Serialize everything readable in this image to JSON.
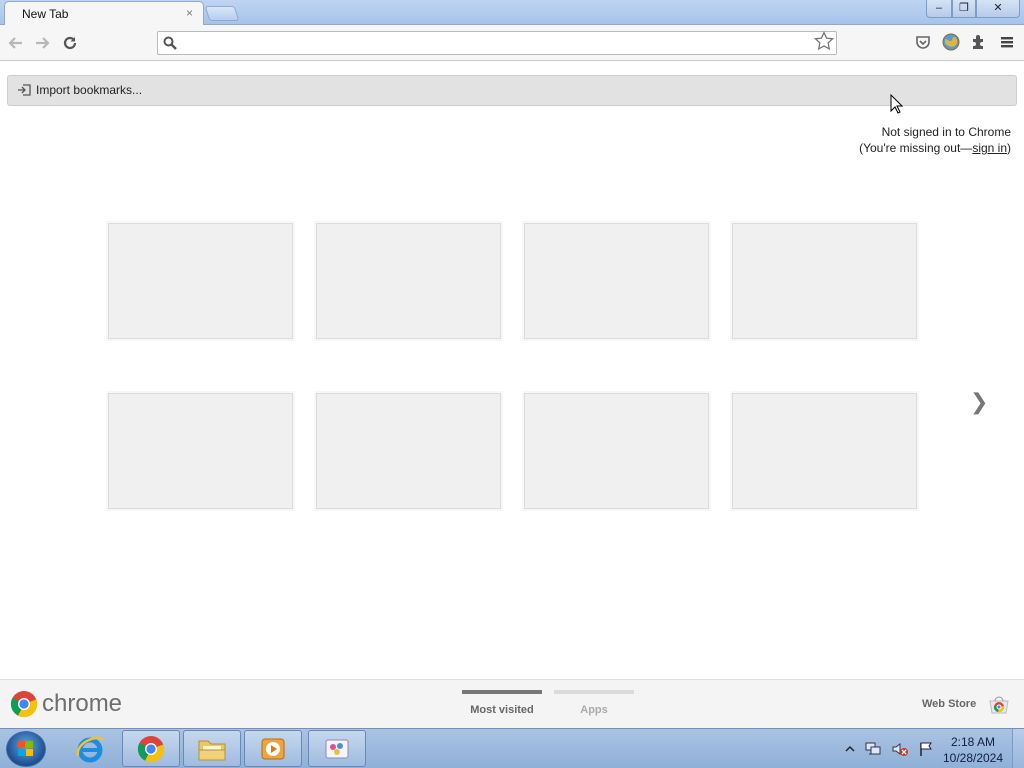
{
  "tab": {
    "title": "New Tab",
    "close": "×"
  },
  "window": {
    "minimize": "–",
    "maximize": "❐",
    "close": "✕"
  },
  "toolbar": {
    "omnibox_value": "",
    "omnibox_placeholder": ""
  },
  "bookmarks": {
    "import_label": "Import bookmarks..."
  },
  "signin": {
    "line1": "Not signed in to Chrome",
    "line2_prefix": "(You're missing out—",
    "link": "sign in",
    "line2_suffix": ")"
  },
  "tiles": {
    "count": 8
  },
  "next_arrow": "❯",
  "footer": {
    "brand": "chrome",
    "tabs": [
      {
        "label": "Most visited",
        "active": true
      },
      {
        "label": "Apps",
        "active": false
      }
    ],
    "webstore": "Web Store"
  },
  "taskbar": {
    "items": [
      "windows-start",
      "internet-explorer",
      "chrome",
      "file-explorer",
      "media-player",
      "paint"
    ],
    "clock": {
      "time": "2:18 AM",
      "date": "10/28/2024"
    }
  },
  "colors": {
    "tab_strip": "#bfd4f2",
    "toolbar": "#f6f6f6",
    "tile": "#f0f0f0",
    "taskbar": "#9fbbe0"
  }
}
